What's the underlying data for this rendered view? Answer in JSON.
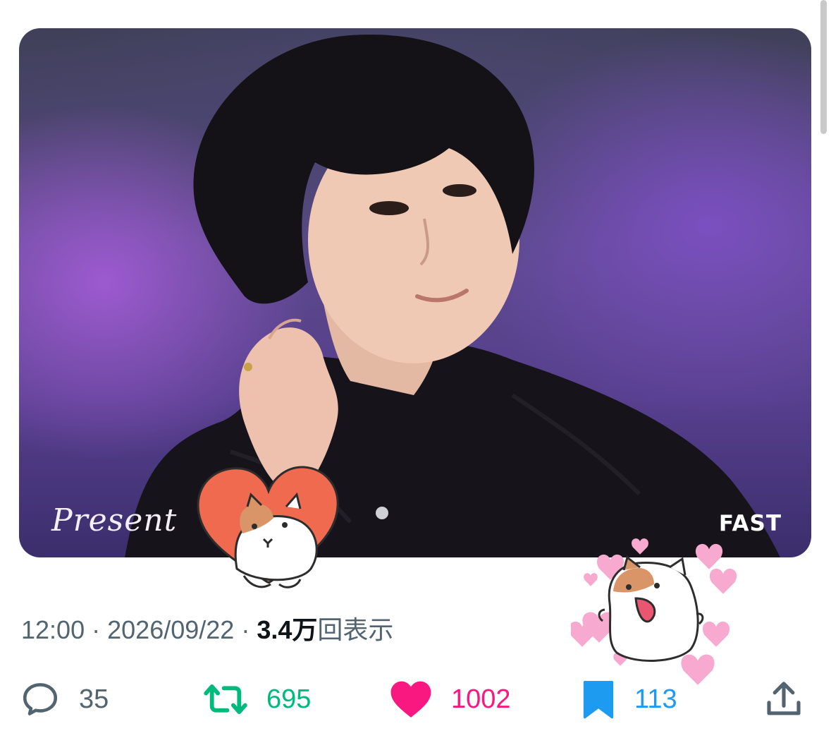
{
  "post": {
    "time": "12:00",
    "separator": "·",
    "date": "2026/09/22",
    "views_count": "3.4万",
    "views_label": "回表示"
  },
  "media": {
    "watermark_left": "Present",
    "watermark_right": "FAST",
    "stickers": [
      "cat-in-heart-sticker",
      "happy-cat-with-hearts-sticker"
    ]
  },
  "actions": {
    "reply_count": "35",
    "retweet_count": "695",
    "like_count": "1002",
    "bookmark_count": "113"
  },
  "colors": {
    "reply": "#536471",
    "retweet": "#00ba7c",
    "like": "#f91880",
    "bookmark": "#1d9bf0",
    "text_primary": "#0f1419",
    "text_secondary": "#536471"
  },
  "icons": {
    "reply": "speech-bubble-icon",
    "retweet": "retweet-arrows-icon",
    "like": "heart-icon",
    "bookmark": "bookmark-icon",
    "share": "share-upload-icon"
  }
}
